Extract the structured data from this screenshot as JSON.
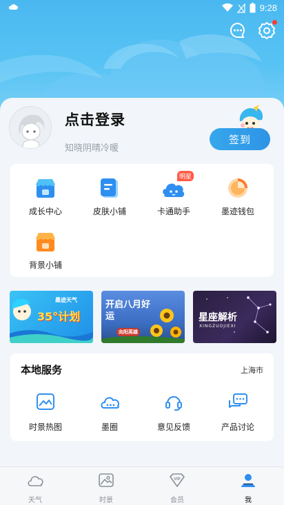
{
  "status_bar": {
    "time": "9:28"
  },
  "profile": {
    "login_title": "点击登录",
    "subtitle": "知晓阴晴冷暖",
    "signin_label": "签到"
  },
  "features": [
    {
      "label": "成长中心",
      "icon": "shop-icon"
    },
    {
      "label": "皮肤小铺",
      "icon": "skin-icon"
    },
    {
      "label": "卡通助手",
      "icon": "cartoon-icon",
      "tag": "明星"
    },
    {
      "label": "墨迹钱包",
      "icon": "wallet-icon"
    },
    {
      "label": "背景小铺",
      "icon": "background-shop-icon"
    }
  ],
  "banners": [
    {
      "text": "35°计划",
      "subtext": "墨迹天气"
    },
    {
      "text": "开启八月好运",
      "subtext": "向阳英雄"
    },
    {
      "text": "星座解析",
      "subtext": "XINGZUOJIEXI"
    }
  ],
  "local_service": {
    "title": "本地服务",
    "city": "上海市",
    "items": [
      {
        "label": "时景热图",
        "icon": "photo-heatmap-icon"
      },
      {
        "label": "墨圈",
        "icon": "cloud-circle-icon"
      },
      {
        "label": "意见反馈",
        "icon": "headset-icon"
      },
      {
        "label": "产品讨论",
        "icon": "chat-discuss-icon"
      }
    ]
  },
  "tabbar": [
    {
      "label": "天气",
      "icon": "cloud-icon"
    },
    {
      "label": "时景",
      "icon": "photo-icon"
    },
    {
      "label": "会员",
      "icon": "vip-icon"
    },
    {
      "label": "我",
      "icon": "profile-icon",
      "active": true
    }
  ],
  "colors": {
    "accent": "#2e94e6",
    "header": "#4ab8f0",
    "badge": "#ff3b30"
  }
}
